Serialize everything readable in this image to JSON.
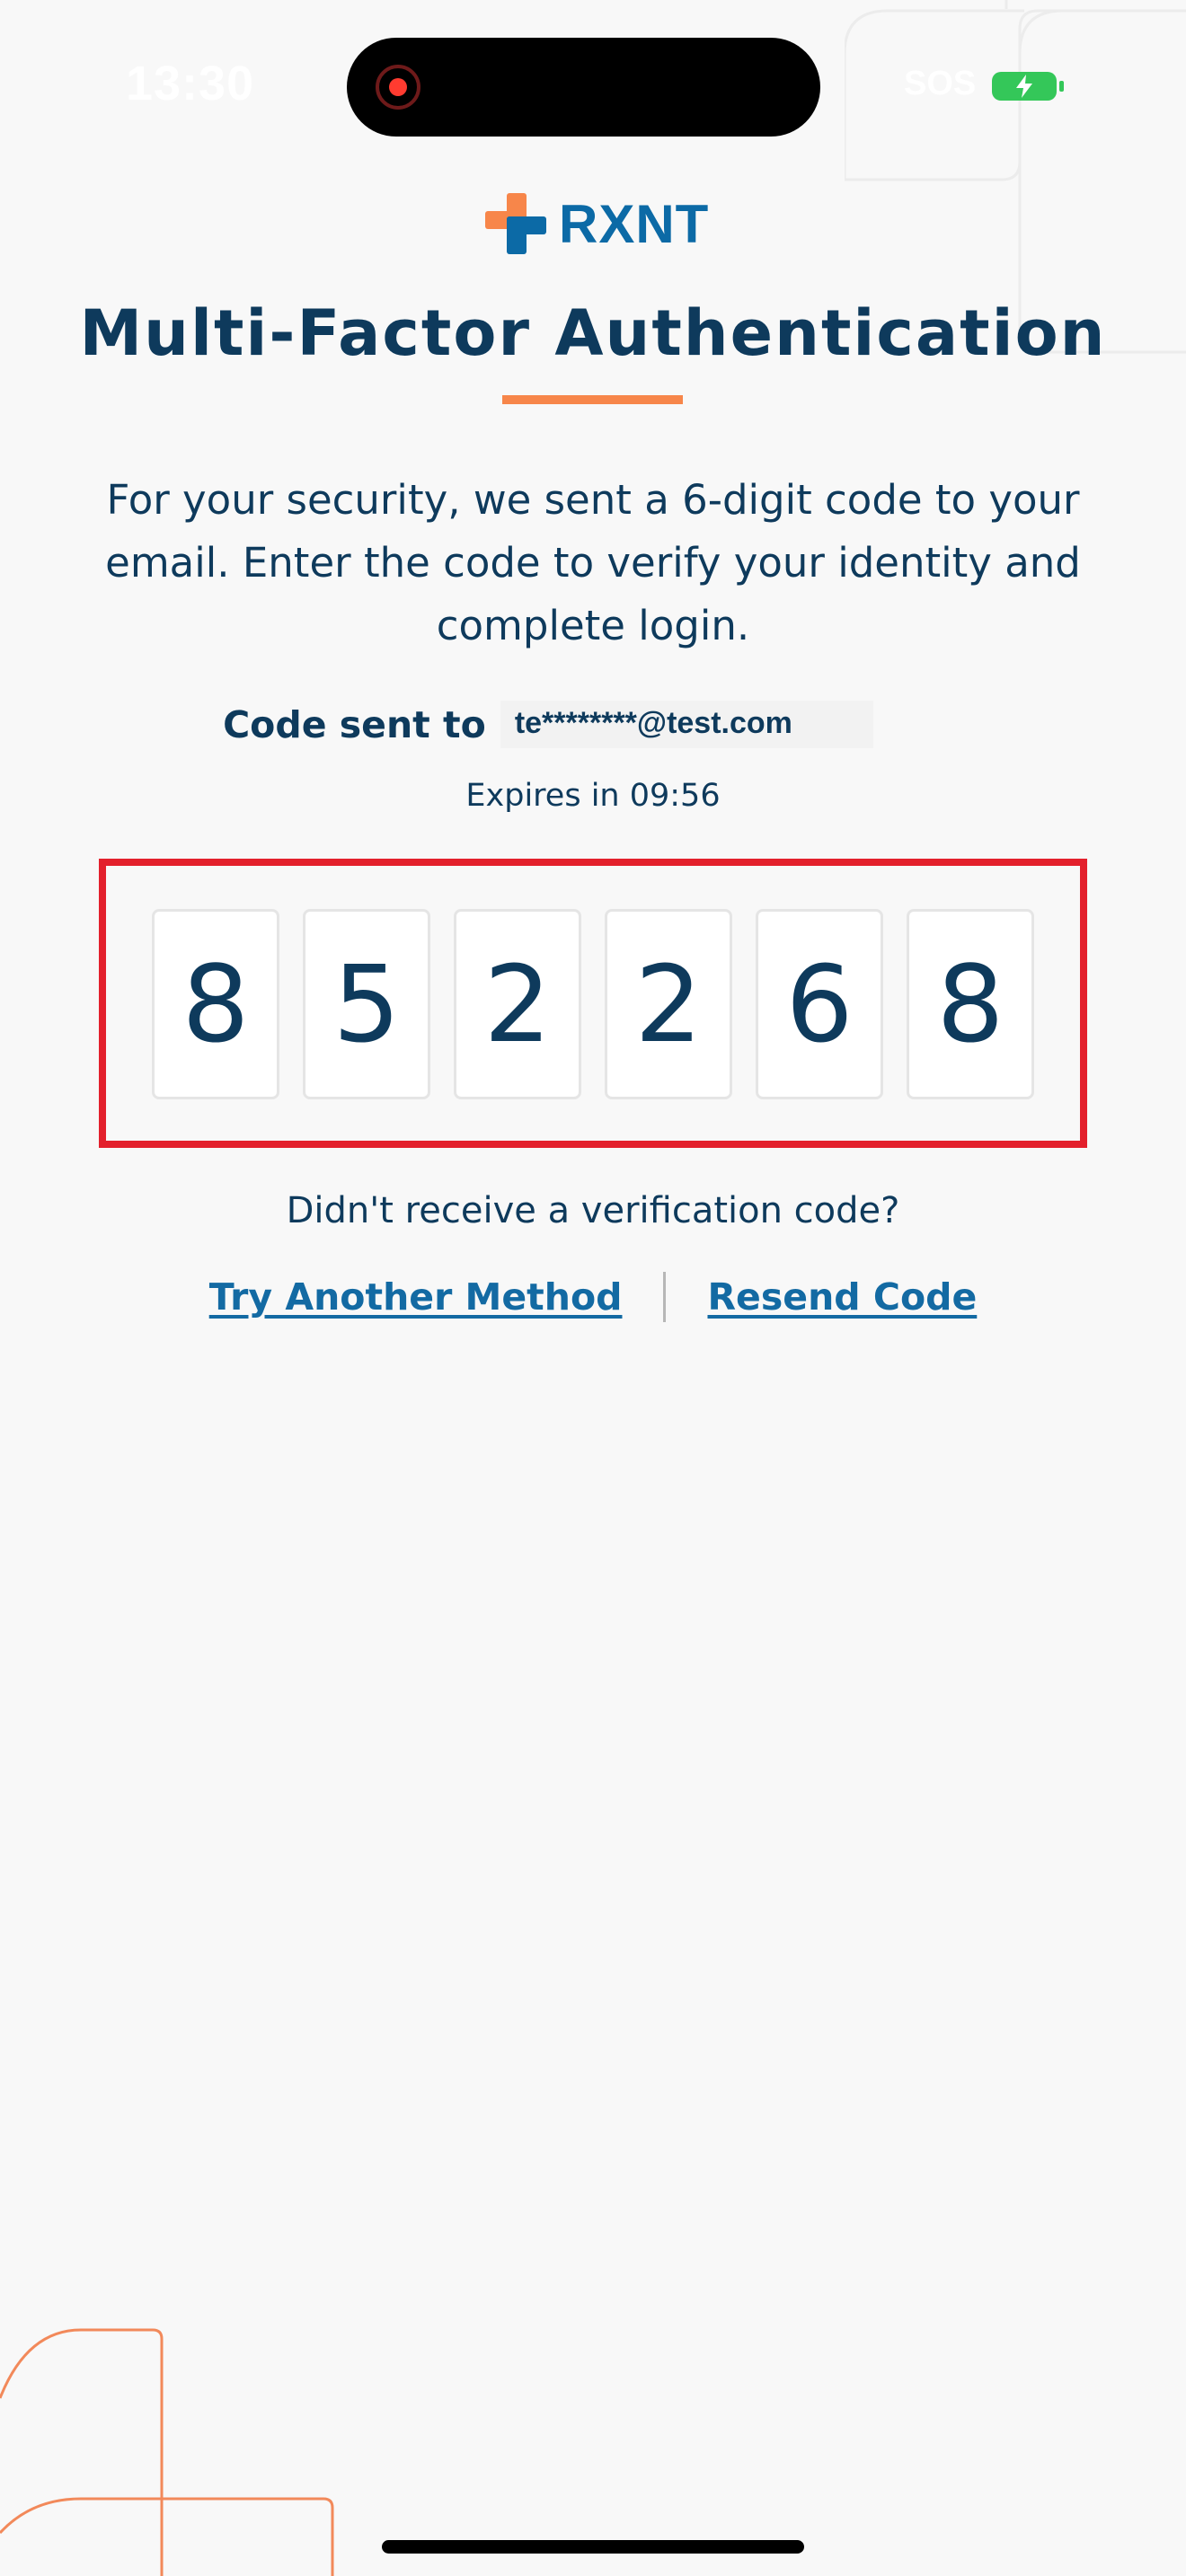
{
  "status_bar": {
    "time": "13:30",
    "carrier": "SOS"
  },
  "brand": {
    "name": "RXNT",
    "accent_color": "#f7864a",
    "primary_color": "#0c6aa6"
  },
  "page": {
    "title": "Multi-Factor Authentication",
    "description": "For your security, we sent a 6-digit code to your email. Enter the code to verify your identity and complete login.",
    "code_sent_label": "Code sent to",
    "masked_email": "te********@test.com",
    "expires_text": "Expires in 09:56"
  },
  "otp": {
    "digits": [
      "8",
      "5",
      "2",
      "2",
      "6",
      "8"
    ],
    "highlight_color": "#e3202c"
  },
  "help": {
    "question": "Didn't receive a verification code?",
    "try_another_label": "Try Another Method",
    "resend_label": "Resend Code"
  },
  "icons": {
    "logo": "rxnt-cross-logo-icon",
    "recording": "screen-recording-icon",
    "battery": "battery-charging-icon"
  }
}
